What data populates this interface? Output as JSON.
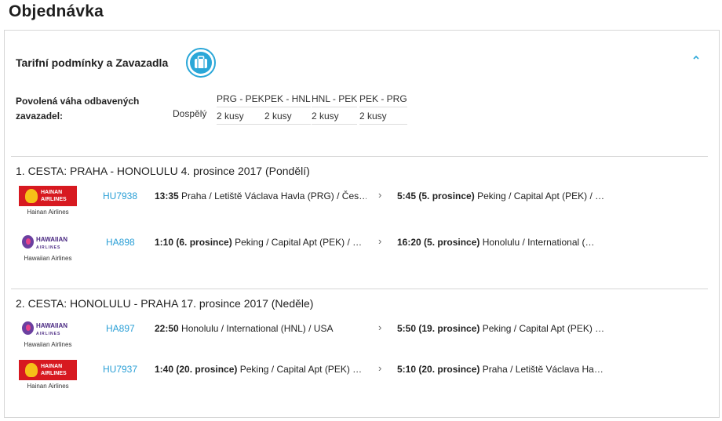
{
  "page": {
    "title": "Objednávka"
  },
  "baggage": {
    "section_title": "Tarifní podmínky a Zavazadla",
    "icon": "suitcase-icon",
    "collapse_icon": "chevron-up-icon",
    "allowance_label": "Povolená váha odbavených zavazadel:",
    "passenger_type": "Dospělý",
    "segments": [
      {
        "route": "PRG - PEK",
        "allowance": "2 kusy"
      },
      {
        "route": "PEK - HNL",
        "allowance": "2 kusy"
      },
      {
        "route": "HNL - PEK",
        "allowance": "2 kusy"
      },
      {
        "route": "PEK - PRG",
        "allowance": "2 kusy"
      }
    ]
  },
  "trips": [
    {
      "title": "1. CESTA: PRAHA - HONOLULU 4. prosince 2017 (Pondělí)",
      "flights": [
        {
          "airline": "Hainan Airlines",
          "logo_text": "HAINAN AIRLINES",
          "flight_no": "HU7938",
          "dep_time": "13:35",
          "dep_date": "",
          "dep_place": "Praha / Letiště Václava Havla (PRG) / Čes…",
          "arr_time": "5:45",
          "arr_date": "(5. prosince)",
          "arr_place": "Peking / Capital Apt (PEK) / …"
        },
        {
          "airline": "Hawaiian Airlines",
          "logo_text": "HAWAIIAN",
          "logo_sub": "AIRLINES",
          "flight_no": "HA898",
          "dep_time": "1:10",
          "dep_date": "(6. prosince)",
          "dep_place": "Peking / Capital Apt (PEK) / …",
          "arr_time": "16:20",
          "arr_date": "(5. prosince)",
          "arr_place": "Honolulu / International (…"
        }
      ]
    },
    {
      "title": "2. CESTA: HONOLULU - PRAHA 17. prosince 2017 (Neděle)",
      "flights": [
        {
          "airline": "Hawaiian Airlines",
          "logo_text": "HAWAIIAN",
          "logo_sub": "AIRLINES",
          "flight_no": "HA897",
          "dep_time": "22:50",
          "dep_date": "",
          "dep_place": "Honolulu / International (HNL) / USA",
          "arr_time": "5:50",
          "arr_date": "(19. prosince)",
          "arr_place": "Peking / Capital Apt (PEK) …"
        },
        {
          "airline": "Hainan Airlines",
          "logo_text": "HAINAN AIRLINES",
          "flight_no": "HU7937",
          "dep_time": "1:40",
          "dep_date": "(20. prosince)",
          "dep_place": "Peking / Capital Apt (PEK) …",
          "arr_time": "5:10",
          "arr_date": "(20. prosince)",
          "arr_place": "Praha / Letiště Václava Ha…"
        }
      ]
    }
  ],
  "arrow_glyph": "›",
  "colors": {
    "accent": "#2aa7d8",
    "link": "#2a9fd6",
    "hainan_red": "#d71920",
    "hawaiian_purple": "#4b2a83"
  }
}
